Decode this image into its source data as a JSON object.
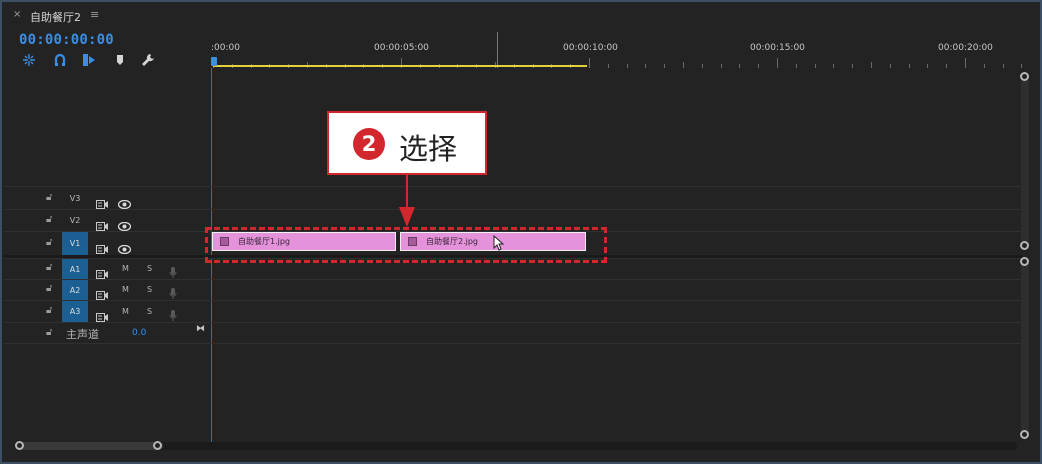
{
  "panel": {
    "close_glyph": "×",
    "title": "自助餐厅2",
    "menu_glyph": "≡"
  },
  "timecode": "00:00:00:00",
  "tools": [
    "snap-icon",
    "linked-selection-icon",
    "add-marker-icon",
    "marker-icon",
    "wrench-icon"
  ],
  "ruler": {
    "labels": [
      ":00:00",
      "00:00:05:00",
      "00:00:10:00",
      "00:00:15:00",
      "00:00:20:00"
    ]
  },
  "tracks": {
    "video": [
      {
        "name": "V3",
        "active": false
      },
      {
        "name": "V2",
        "active": false
      },
      {
        "name": "V1",
        "active": true
      }
    ],
    "audio": [
      {
        "name": "A1",
        "mute": "M",
        "solo": "S"
      },
      {
        "name": "A2",
        "mute": "M",
        "solo": "S"
      },
      {
        "name": "A3",
        "mute": "M",
        "solo": "S"
      }
    ],
    "master": {
      "label": "主声道",
      "value": "0.0"
    }
  },
  "clips": [
    {
      "name": "自助餐厅1.jpg"
    },
    {
      "name": "自助餐厅2.jpg"
    }
  ],
  "annotation": {
    "number": "2",
    "text": "选择",
    "color": "#d2272d"
  },
  "colors": {
    "accent": "#3a8ee6",
    "clip": "#e493db",
    "in_out_bar": "#e2d13c"
  }
}
